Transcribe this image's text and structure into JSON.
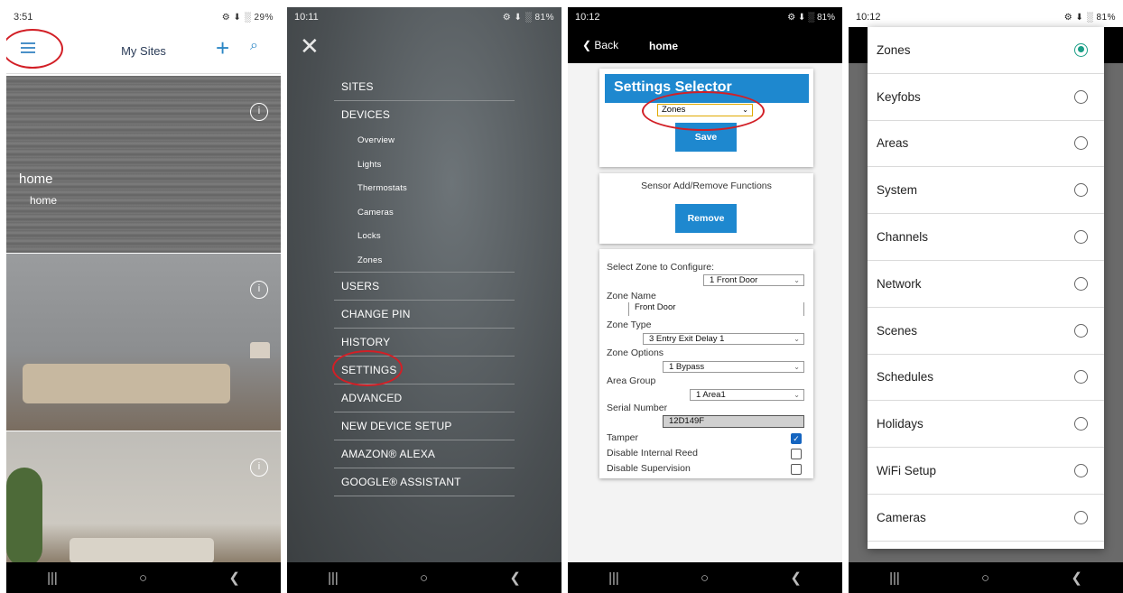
{
  "panel1": {
    "status": {
      "time": "3:51",
      "icons": "⚙ ⬇ ░ 29%"
    },
    "title": "My Sites",
    "plus_icon": "+",
    "search_icon": "⌕",
    "sites": [
      {
        "name": "home",
        "sub": "home",
        "info": "i"
      },
      {
        "info": "i"
      },
      {
        "info": "i"
      }
    ]
  },
  "panel2": {
    "status": {
      "time": "10:11",
      "icons": "⚙ ⬇ ░ 81%"
    },
    "close_icon": "✕",
    "menu": [
      {
        "label": "SITES",
        "sub": false
      },
      {
        "label": "DEVICES",
        "sub": false
      },
      {
        "label": "Overview",
        "sub": true
      },
      {
        "label": "Lights",
        "sub": true
      },
      {
        "label": "Thermostats",
        "sub": true
      },
      {
        "label": "Cameras",
        "sub": true
      },
      {
        "label": "Locks",
        "sub": true
      },
      {
        "label": "Zones",
        "sub": true
      },
      {
        "label": "USERS",
        "sub": false
      },
      {
        "label": "CHANGE PIN",
        "sub": false
      },
      {
        "label": "HISTORY",
        "sub": false
      },
      {
        "label": "SETTINGS",
        "sub": false
      },
      {
        "label": "ADVANCED",
        "sub": false
      },
      {
        "label": "NEW DEVICE SETUP",
        "sub": false
      },
      {
        "label": "AMAZON® ALEXA",
        "sub": false
      },
      {
        "label": "GOOGLE® ASSISTANT",
        "sub": false
      }
    ]
  },
  "panel3": {
    "status": {
      "time": "10:12",
      "icons": "⚙ ⬇ ░ 81%"
    },
    "back": "❮  Back",
    "title": "home",
    "selector_title": "Settings Selector",
    "selector_value": "Zones",
    "save": "Save",
    "sensor_label": "Sensor Add/Remove Functions",
    "remove": "Remove",
    "zone_configure_label": "Select Zone to Configure:",
    "zone_configure_value": "1 Front Door",
    "zone_name_label": "Zone Name",
    "zone_name_value": "Front Door",
    "zone_type_label": "Zone Type",
    "zone_type_value": "3 Entry Exit Delay 1",
    "zone_options_label": "Zone Options",
    "zone_options_value": "1 Bypass",
    "area_group_label": "Area Group",
    "area_group_value": "1 Area1",
    "serial_label": "Serial Number",
    "serial_value": "12D149F",
    "tamper_label": "Tamper",
    "tamper_checked": true,
    "reed_label": "Disable Internal Reed",
    "reed_checked": false,
    "supervision_label": "Disable Supervision",
    "supervision_checked": false
  },
  "panel4": {
    "status": {
      "time": "10:12",
      "icons": "⚙ ⬇ ░ 81%"
    },
    "options": [
      {
        "label": "Zones",
        "selected": true
      },
      {
        "label": "Keyfobs",
        "selected": false
      },
      {
        "label": "Areas",
        "selected": false
      },
      {
        "label": "System",
        "selected": false
      },
      {
        "label": "Channels",
        "selected": false
      },
      {
        "label": "Network",
        "selected": false
      },
      {
        "label": "Scenes",
        "selected": false
      },
      {
        "label": "Schedules",
        "selected": false
      },
      {
        "label": "Holidays",
        "selected": false
      },
      {
        "label": "WiFi Setup",
        "selected": false
      },
      {
        "label": "Cameras",
        "selected": false
      }
    ]
  },
  "navbar": {
    "recent": "|||",
    "home": "○",
    "back": "❮"
  },
  "colors": {
    "accent": "#1e88cf",
    "highlight_circle": "#d21f26",
    "radio_selected": "#1a9e86"
  }
}
